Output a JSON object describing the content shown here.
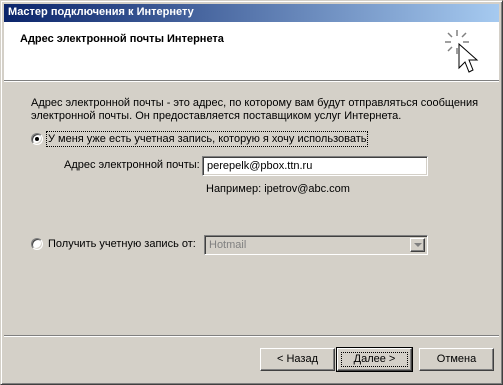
{
  "window": {
    "title": "Мастер подключения к Интернету"
  },
  "header": {
    "title": "Адрес электронной почты Интернета",
    "icon": "wizard-wand-icon"
  },
  "description": "Адрес электронной почты - это адрес, по которому вам будут отправляться сообщения электронной почты. Он предоставляется поставщиком услуг Интернета.",
  "options": {
    "have_account": {
      "label": "У меня уже есть учетная запись, которую я хочу использовать",
      "checked": true
    },
    "get_account": {
      "label": "Получить учетную запись от:",
      "checked": false
    }
  },
  "email": {
    "label": "Адрес электронной почты:",
    "value": "perepelk@pbox.ttn.ru",
    "example": "Например: ipetrov@abc.com"
  },
  "provider_select": {
    "selected": "Hotmail",
    "enabled": false
  },
  "buttons": {
    "back": "< Назад",
    "next": "Далее >",
    "cancel": "Отмена"
  },
  "colors": {
    "titlebar_start": "#0a246a",
    "titlebar_end": "#a6caf0",
    "face": "#d4d0c8"
  }
}
